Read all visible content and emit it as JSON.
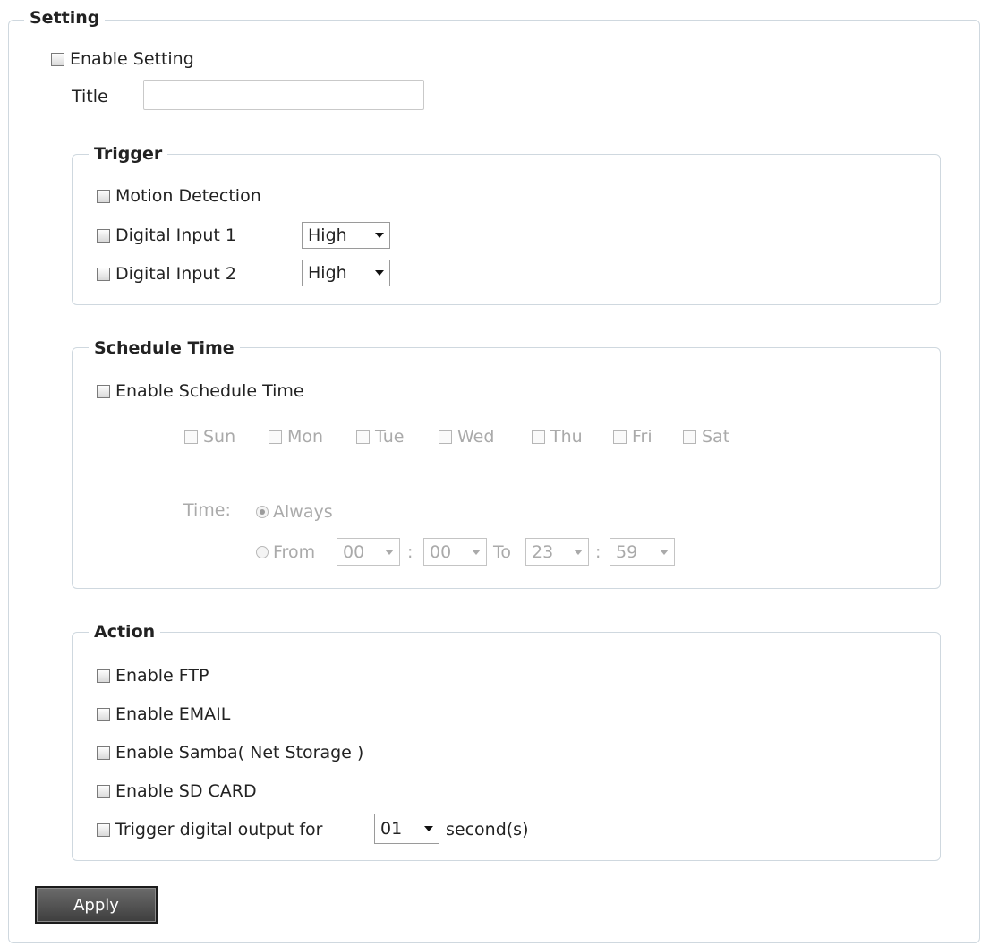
{
  "setting": {
    "legend": "Setting",
    "enable_label": "Enable Setting",
    "title_label": "Title",
    "title_value": ""
  },
  "trigger": {
    "legend": "Trigger",
    "motion_label": "Motion Detection",
    "di1_label": "Digital Input 1",
    "di1_value": "High",
    "di2_label": "Digital Input 2",
    "di2_value": "High"
  },
  "schedule": {
    "legend": "Schedule Time",
    "enable_label": "Enable Schedule Time",
    "days": [
      "Sun",
      "Mon",
      "Tue",
      "Wed",
      "Thu",
      "Fri",
      "Sat"
    ],
    "time_label": "Time:",
    "always_label": "Always",
    "from_label": "From",
    "to_label": "To",
    "colon": ":",
    "from_hour": "00",
    "from_min": "00",
    "to_hour": "23",
    "to_min": "59"
  },
  "action": {
    "legend": "Action",
    "ftp_label": "Enable FTP",
    "email_label": "Enable EMAIL",
    "samba_label": "Enable Samba( Net Storage )",
    "sd_label": "Enable SD CARD",
    "dout_label": "Trigger digital output for",
    "dout_value": "01",
    "dout_unit": "second(s)"
  },
  "apply_label": "Apply"
}
